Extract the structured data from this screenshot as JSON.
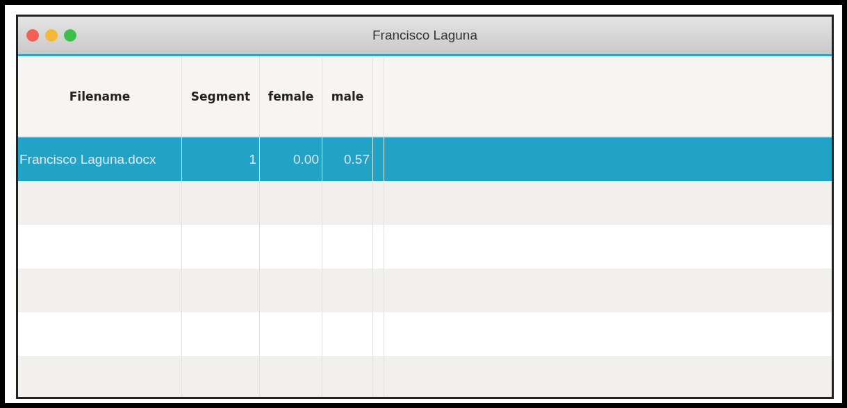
{
  "window": {
    "title": "Francisco Laguna"
  },
  "table": {
    "columns": [
      "Filename",
      "Segment",
      "female",
      "male"
    ],
    "rows": [
      {
        "selected": true,
        "cells": [
          "Francisco Laguna.docx",
          "1",
          "0.00",
          "0.57"
        ]
      }
    ]
  }
}
